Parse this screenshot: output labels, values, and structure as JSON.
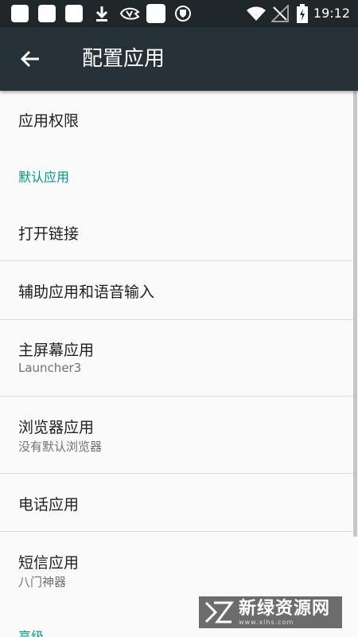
{
  "status_bar": {
    "time": "19:12",
    "icons": [
      "notification-square-icon",
      "notification-square-icon",
      "notification-square-icon",
      "download-icon",
      "app-notification-icon",
      "notification-square-icon",
      "shield-icon",
      "circle-notification-icon",
      "wifi-icon",
      "no-signal-icon",
      "battery-charging-icon"
    ]
  },
  "toolbar": {
    "title": "配置应用",
    "back_icon": "arrow-back-icon"
  },
  "preferences": {
    "app_permissions": "应用权限",
    "default_apps_category": "默认应用",
    "open_links": "打开链接",
    "assist_voice": "辅助应用和语音输入",
    "home_app": {
      "title": "主屏幕应用",
      "summary": "Launcher3"
    },
    "browser_app": {
      "title": "浏览器应用",
      "summary": "没有默认浏览器"
    },
    "phone_app": "电话应用",
    "sms_app": {
      "title": "短信应用",
      "summary": "八门神器"
    },
    "advanced_category": "高级"
  },
  "watermark": {
    "text": "新绿资源网",
    "url": "www.xlhs.com"
  },
  "colors": {
    "status_bar": "#1f272b",
    "toolbar": "#263238",
    "category": "#009688",
    "background": "#fafafa"
  }
}
